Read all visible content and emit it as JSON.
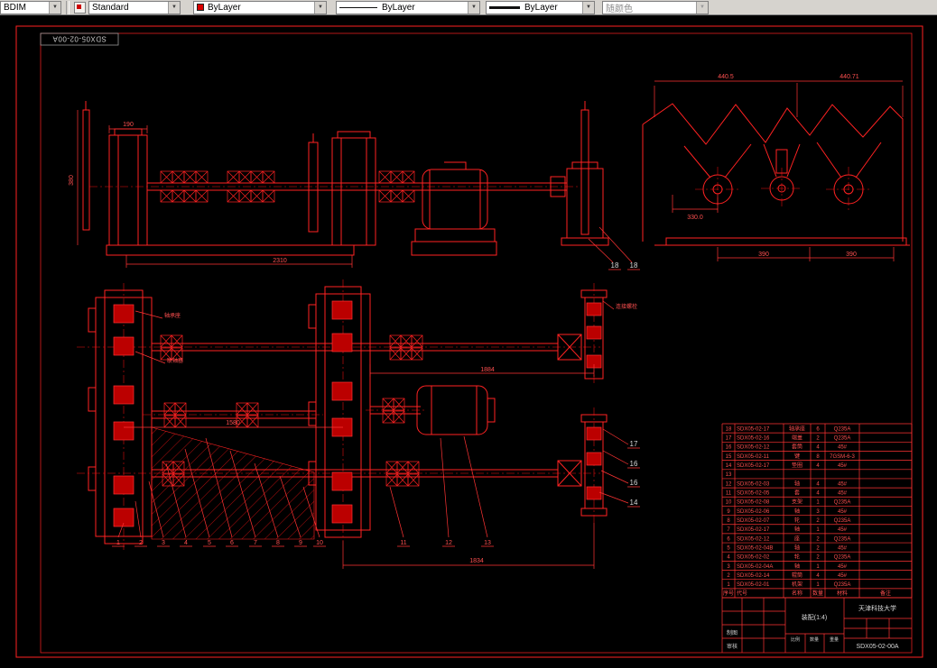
{
  "toolbar": {
    "layer_value": "BDIM",
    "style_value": "Standard",
    "color_value": "ByLayer",
    "linetype_value": "ByLayer",
    "lineweight_value": "ByLayer",
    "plotstyle_value": "随颜色"
  },
  "sheet": {
    "frame_label": "SDX05-02-00A"
  },
  "front_view": {
    "dim_190": "190",
    "dim_380": "380",
    "dim_2310": "2310",
    "balloons": [
      "18",
      "18"
    ]
  },
  "detail_view": {
    "dim_440_5": "440.5",
    "dim_440_71": "440.71",
    "dim_330": "330.0",
    "dim_390_left": "390",
    "dim_390_right": "390"
  },
  "plan_view": {
    "dim_1884": "1884",
    "dim_1580": "1580",
    "dim_1834": "1834",
    "balloons_bottom": [
      "1",
      "2",
      "3",
      "4",
      "5",
      "6",
      "7",
      "8",
      "9",
      "10"
    ],
    "balloons_mid": [
      "11",
      "12",
      "13"
    ],
    "balloons_right": [
      "17",
      "16",
      "16",
      "14"
    ],
    "annotations": [
      "轴承座",
      "联轴器",
      "连接螺栓"
    ]
  },
  "parts_table": {
    "header": [
      "序号",
      "代号",
      "名称",
      "数量",
      "材料",
      "备注"
    ],
    "rows": [
      [
        "18",
        "SDX05-02-17",
        "轴承座",
        "6",
        "Q235A",
        ""
      ],
      [
        "17",
        "SDX05-02-16",
        "端盖",
        "2",
        "Q235A",
        ""
      ],
      [
        "16",
        "SDX05-02-12",
        "套筒",
        "4",
        "45#",
        ""
      ],
      [
        "15",
        "SDX05-02-11",
        "键",
        "8",
        "7GSM-6-3",
        ""
      ],
      [
        "14",
        "SDX05-02-17",
        "垫圈",
        "4",
        "45#",
        ""
      ],
      [
        "13",
        "",
        "",
        "",
        "",
        ""
      ],
      [
        "12",
        "SDX05-02-03",
        "轴",
        "4",
        "45#",
        ""
      ],
      [
        "11",
        "SDX05-02-05",
        "套",
        "4",
        "45#",
        ""
      ],
      [
        "10",
        "SDX05-02-08",
        "支架",
        "1",
        "Q235A",
        ""
      ],
      [
        "9",
        "SDX05-02-06",
        "轴",
        "3",
        "45#",
        ""
      ],
      [
        "8",
        "SDX05-02-07",
        "轮",
        "2",
        "Q235A",
        ""
      ],
      [
        "7",
        "SDX05-02-17",
        "轴",
        "1",
        "45#",
        ""
      ],
      [
        "6",
        "SDX05-02-12",
        "座",
        "2",
        "Q235A",
        ""
      ],
      [
        "5",
        "SDX05-02-04B",
        "轴",
        "2",
        "45#",
        ""
      ],
      [
        "4",
        "SDX05-02-02",
        "轮",
        "2",
        "Q235A",
        ""
      ],
      [
        "3",
        "SDX05-02-04A",
        "轴",
        "1",
        "45#",
        ""
      ],
      [
        "2",
        "SDX05-02-14",
        "辊筒",
        "4",
        "45#",
        ""
      ],
      [
        "1",
        "SDX05-02-01",
        "机架",
        "1",
        "Q235A",
        ""
      ]
    ]
  },
  "title_block": {
    "company": "天津科技大学",
    "title": "装配(1:4)",
    "drawing_no": "SDX05-02-00A",
    "left_labels": [
      "制图",
      "审核"
    ],
    "small_labels": [
      "比例",
      "数量",
      "重量"
    ]
  },
  "colors": {
    "line": "#ff2222",
    "white_text": "#d8d8d8",
    "background": "#000000"
  }
}
